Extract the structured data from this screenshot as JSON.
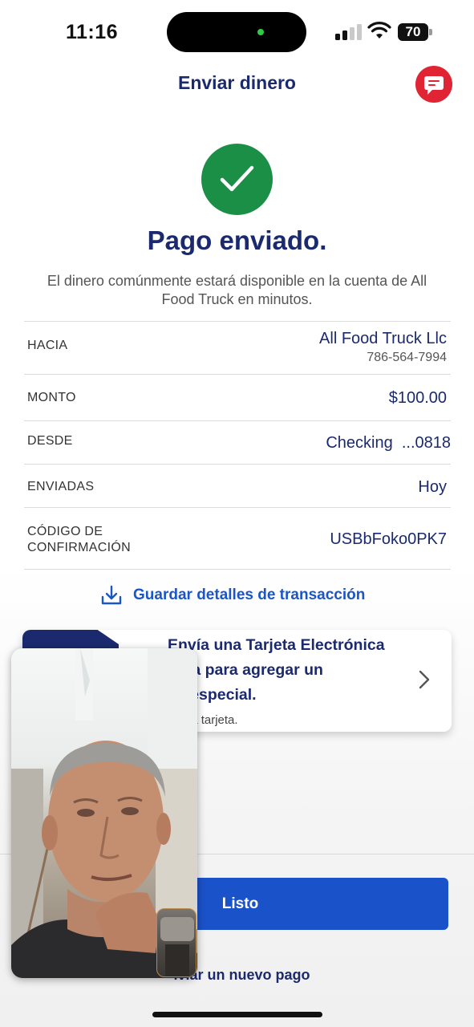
{
  "status_bar": {
    "time": "11:16",
    "battery": "70"
  },
  "header": {
    "title": "Enviar dinero",
    "chat_icon": "chat-bubble-icon",
    "accent": "#e12434"
  },
  "success": {
    "icon": "checkmark-icon",
    "title": "Pago enviado.",
    "subtitle": "El dinero comúnmente estará disponible en la cuenta de All Food Truck en minutos."
  },
  "details": [
    {
      "label": "HACIA",
      "value": "All Food Truck Llc",
      "subvalue": "786-564-7994"
    },
    {
      "label": "MONTO",
      "value": "$100.00"
    },
    {
      "label": "DESDE",
      "value": "Checking  ...0818"
    },
    {
      "label": "ENVIADAS",
      "value": "Hoy"
    },
    {
      "label": "CÓDIGO DE\nCONFIRMACIÓN",
      "value": "USBbFoko0PK7"
    }
  ],
  "save_link": {
    "label": "Guardar detalles de transacción",
    "icon": "download-icon"
  },
  "promo": {
    "text": "Envía una Tarjeta Electrónica gratuita para agregar un toque especial.",
    "subtext": "Envíe una tarjeta.",
    "visible_text": "Envía una Tarjeta Electrónica\ntuita para agregar un\nue especial.",
    "visible_subtext": "e una tarjeta."
  },
  "actions": {
    "done_label": "Listo",
    "new_payment_label": "Enviar un nuevo pago",
    "new_payment_visible": "iviar un nuevo pago"
  },
  "colors": {
    "brand_navy": "#1b2a6e",
    "primary_blue": "#1a52c9",
    "success_green": "#1b8f45"
  }
}
